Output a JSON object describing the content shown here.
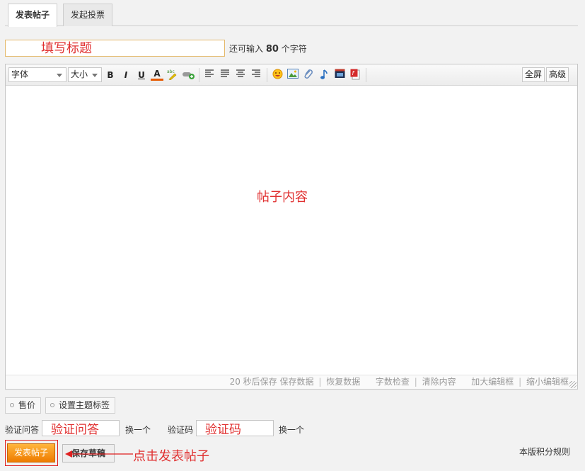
{
  "tabs": [
    {
      "label": "发表帖子",
      "active": true
    },
    {
      "label": "发起投票",
      "active": false
    }
  ],
  "title_field": {
    "placeholder": "填写标题",
    "hint_prefix": "还可输入",
    "hint_count": "80",
    "hint_suffix": "个字符"
  },
  "toolbar": {
    "font_select": "字体",
    "size_select": "大小",
    "bold": "B",
    "italic": "I",
    "underline": "U",
    "font_color": "A",
    "fullscreen": "全屏",
    "advanced": "高级"
  },
  "editor": {
    "placeholder": "帖子内容"
  },
  "status_bar": {
    "autosave": "20 秒后保存",
    "save_data": "保存数据",
    "restore_data": "恢复数据",
    "word_check": "字数检查",
    "clear_content": "清除内容",
    "enlarge": "加大编辑框",
    "shrink": "缩小编辑框",
    "separator": "|"
  },
  "options": {
    "sell_price": "售价",
    "set_tags": "设置主题标签"
  },
  "verify": {
    "question_label": "验证问答",
    "question_value": "验证问答",
    "question_change": "换一个",
    "code_label": "验证码",
    "code_value": "验证码",
    "code_change": "换一个"
  },
  "actions": {
    "submit": "发表帖子",
    "save_draft": "保存草稿",
    "annotation": "点击发表帖子",
    "rules_link": "本版积分规则"
  },
  "colors": {
    "annotation_red": "#e03030",
    "submit_orange": "#ee7c00",
    "title_border": "#e4b96b"
  }
}
